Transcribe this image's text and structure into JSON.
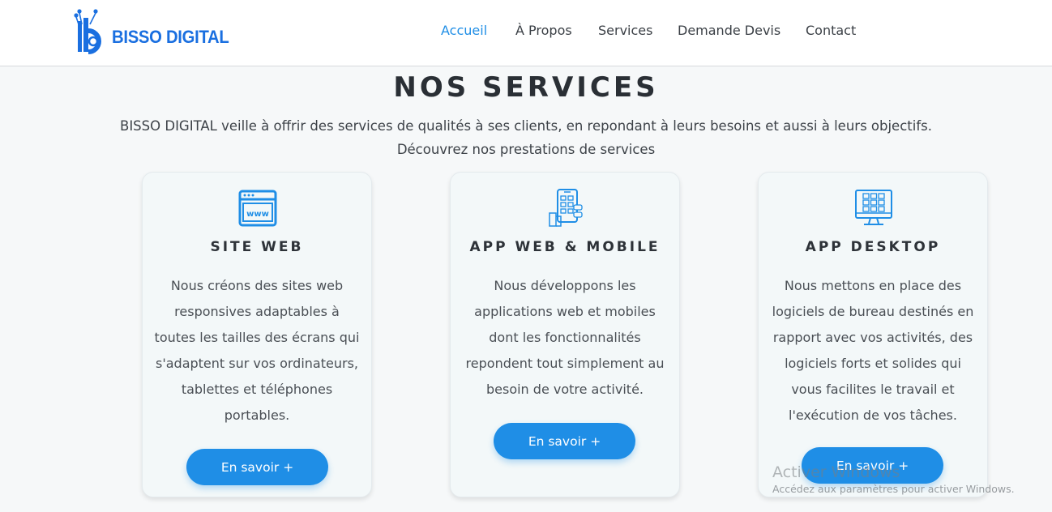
{
  "brand": {
    "name": "BISSO DIGITAL",
    "color": "#1a6fe0"
  },
  "nav": {
    "items": [
      {
        "label": "Accueil",
        "active": true
      },
      {
        "label": "À Propos",
        "active": false
      },
      {
        "label": "Services",
        "active": false
      },
      {
        "label": "Demande Devis",
        "active": false
      },
      {
        "label": "Contact",
        "active": false
      }
    ]
  },
  "services": {
    "title": "NOS SERVICES",
    "intro_line1": "BISSO DIGITAL veille à offrir des services de qualités à ses clients, en repondant à leurs besoins et aussi à leurs objectifs.",
    "intro_line2": "Découvrez nos prestations de services",
    "cards": [
      {
        "icon": "www-browser-icon",
        "title": "SITE WEB",
        "description": "Nous créons des sites web responsives adaptables à toutes les tailles des écrans qui s'adaptent sur vos ordinateurs, tablettes et téléphones portables.",
        "button": "En savoir +"
      },
      {
        "icon": "mobile-app-icon",
        "title": "APP WEB & MOBILE",
        "description": "Nous développons les applications web et mobiles dont les fonctionnalités repondent tout simplement au besoin de votre activité.",
        "button": "En savoir +"
      },
      {
        "icon": "desktop-monitor-icon",
        "title": "APP DESKTOP",
        "description": "Nous mettons en place des logiciels de bureau destinés en rapport avec vos activités, des logiciels forts et solides qui vous facilites le travail et l'exécution de vos tâches.",
        "button": "En savoir +"
      }
    ]
  },
  "watermark": {
    "title": "Activer Windows",
    "subtitle": "Accédez aux paramètres pour activer Windows."
  },
  "colors": {
    "accent": "#1f8ee6",
    "background": "#f6f8f9",
    "card": "#f3f8f9"
  }
}
